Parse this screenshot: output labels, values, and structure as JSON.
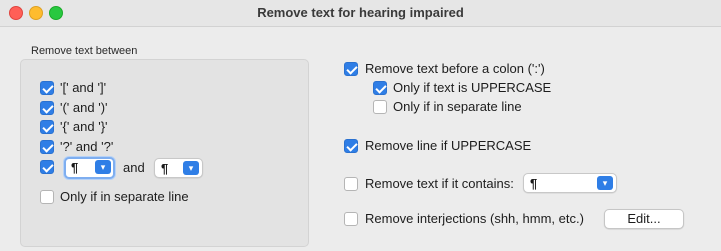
{
  "window": {
    "title": "Remove text for hearing impaired"
  },
  "left_group": {
    "title": "Remove text between",
    "items": [
      {
        "label": "'[' and ']'",
        "checked": true
      },
      {
        "label": "'(' and ')'",
        "checked": true
      },
      {
        "label": "'{' and '}'",
        "checked": true
      },
      {
        "label": "'?' and '?'",
        "checked": true
      }
    ],
    "custom_pair": {
      "checked": true,
      "start_value": "¶",
      "and_label": "and",
      "end_value": "¶"
    },
    "separate_line": {
      "label": "Only if in separate line",
      "checked": false
    }
  },
  "right": {
    "before_colon": {
      "label": "Remove text before a colon (':')",
      "checked": true
    },
    "only_uppercase": {
      "label": "Only if text is UPPERCASE",
      "checked": true
    },
    "only_separate_line": {
      "label": "Only if in separate line",
      "checked": false
    },
    "remove_line_uppercase": {
      "label": "Remove line if UPPERCASE",
      "checked": true
    },
    "contains": {
      "label": "Remove text if it contains:",
      "checked": false,
      "value": "¶"
    },
    "interjections": {
      "label": "Remove interjections (shh, hmm, etc.)",
      "checked": false,
      "button_label": "Edit..."
    }
  },
  "icons": {
    "dropdown": "chevron-up-down-icon",
    "checkmark": "checkmark-icon"
  },
  "colors": {
    "accent": "#2f7ee6",
    "focus_ring": "#7eaef0"
  }
}
